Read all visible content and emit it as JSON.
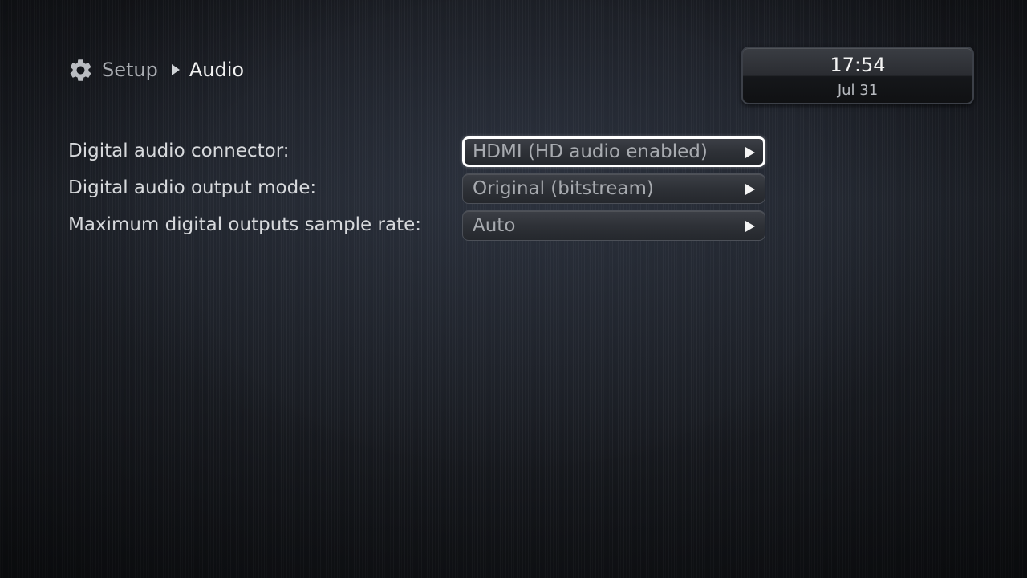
{
  "breadcrumb": {
    "icon": "gear-icon",
    "parent": "Setup",
    "separator_icon": "chevron-right-icon",
    "current": "Audio"
  },
  "clock": {
    "time": "17:54",
    "date": "Jul 31"
  },
  "settings": [
    {
      "label": "Digital audio connector:",
      "value": "HDMI (HD audio enabled)",
      "focused": true
    },
    {
      "label": "Digital audio output mode:",
      "value": "Original (bitstream)",
      "focused": false
    },
    {
      "label": "Maximum digital outputs sample rate:",
      "value": "Auto",
      "focused": false
    }
  ],
  "colors": {
    "background": "#1b1e24",
    "label_text": "#d7d9dc",
    "value_text": "#a8abb0",
    "focus_border": "#ffffff"
  }
}
